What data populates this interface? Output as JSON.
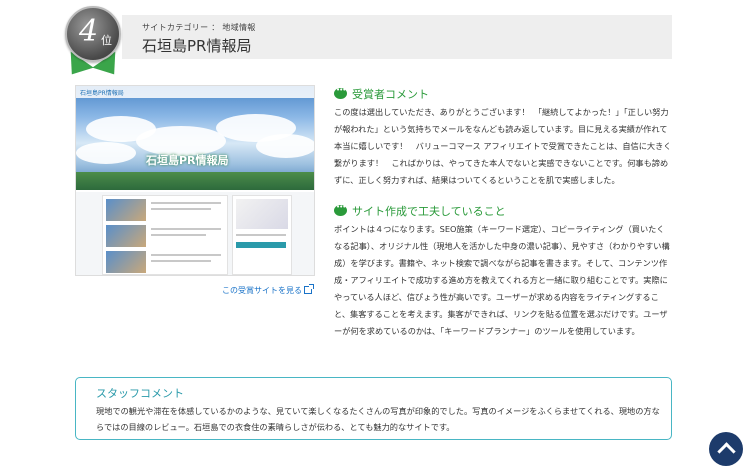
{
  "rank": {
    "number": "4",
    "unit": "位"
  },
  "header": {
    "category": "サイトカテゴリー ： 地域情報",
    "title": "石垣島PR情報局"
  },
  "thumbnail": {
    "nav_logo": "石垣島PR情報局",
    "hero_logo": "石垣島PR情報局"
  },
  "view_site_link": "この受賞サイトを見る",
  "award_comment": {
    "heading": "受賞者コメント",
    "text": "この度は選出していただき、ありがとうございます！　「継続してよかった！」「正しい努力が報われた」という気持ちでメールをなんども読み返しています。目に見える実績が作れて本当に嬉しいです！　バリューコマース アフィリエイトで受賞できたことは、自信に大きく繋がります！　こればかりは、やってきた本人でないと実感できないことです。何事も諦めずに、正しく努力すれば、結果はついてくるということを肌で実感しました。"
  },
  "site_effort": {
    "heading": "サイト作成で工夫していること",
    "text": "ポイントは４つになります。SEO施策（キーワード選定）、コピーライティング（買いたくなる記事）、オリジナル性（現地人を活かした中身の濃い記事）、見やすさ（わかりやすい構成）を学びます。書籍や、ネット検索で調べながら記事を書きます。そして、コンテンツ作成・アフィリエイトで成功する進め方を教えてくれる方と一緒に取り組むことです。実際にやっている人ほど、信ぴょう性が高いです。ユーザーが求める内容をライティングすること、集客することを考えます。集客ができれば、リンクを貼る位置を選ぶだけです。ユーザーが何を求めているのかは、「キーワードプランナー」のツールを使用しています。"
  },
  "staff_comment": {
    "heading": "スタッフコメント",
    "text": "現地での観光や滞在を体感しているかのような、見ていて楽しくなるたくさんの写真が印象的でした。写真のイメージをふくらませてくれる、現地の方ならではの目線のレビュー。石垣島での衣食住の素晴らしさが伝わる、とても魅力的なサイトです。"
  },
  "colors": {
    "accent_green": "#2a9a3a",
    "staff_teal": "#49b6c4",
    "link_blue": "#1a73c8",
    "to_top_navy": "#1d3b6b"
  },
  "icons": [
    "chat-bubble-icon",
    "external-link-icon",
    "chevron-up-icon"
  ]
}
